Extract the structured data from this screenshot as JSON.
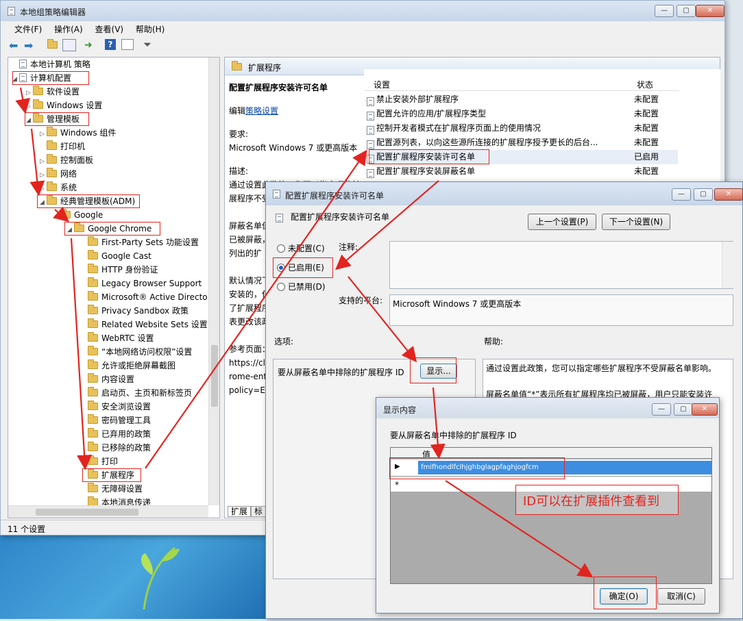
{
  "main_window": {
    "title": "本地组策略编辑器",
    "menu": [
      "文件(F)",
      "操作(A)",
      "查看(V)",
      "帮助(H)"
    ],
    "status": "11 个设置"
  },
  "tree": {
    "items": [
      {
        "label": "本地计算机 策略"
      },
      {
        "label": "计算机配置"
      },
      {
        "label": "软件设置"
      },
      {
        "label": "Windows 设置"
      },
      {
        "label": "管理模板"
      },
      {
        "label": "Windows 组件"
      },
      {
        "label": "打印机"
      },
      {
        "label": "控制面板"
      },
      {
        "label": "网络"
      },
      {
        "label": "系统"
      },
      {
        "label": "经典管理模板(ADM)"
      },
      {
        "label": "Google"
      },
      {
        "label": "Google Chrome"
      },
      {
        "label": "First-Party Sets 功能设置"
      },
      {
        "label": "Google Cast"
      },
      {
        "label": "HTTP 身份验证"
      },
      {
        "label": "Legacy Browser Support"
      },
      {
        "label": "Microsoft® Active Directo"
      },
      {
        "label": "Privacy Sandbox 政策"
      },
      {
        "label": "Related Website Sets 设置"
      },
      {
        "label": "WebRTC 设置"
      },
      {
        "label": "“本地网络访问权限”设置"
      },
      {
        "label": "允许或拒绝屏幕截图"
      },
      {
        "label": "内容设置"
      },
      {
        "label": "启动页、主页和新标签页"
      },
      {
        "label": "安全浏览设置"
      },
      {
        "label": "密码管理工具"
      },
      {
        "label": "已弃用的政策"
      },
      {
        "label": "已移除的政策"
      },
      {
        "label": "打印"
      },
      {
        "label": "扩展程序"
      },
      {
        "label": "无障碍设置"
      },
      {
        "label": "本地消息传递"
      }
    ]
  },
  "detail": {
    "header": "扩展程序",
    "setting_title": "配置扩展程序安装许可名单",
    "edit_prefix": "编辑",
    "edit_link": "策略设置",
    "req_label": "要求:",
    "req_value": "Microsoft Windows 7 或更高版本",
    "desc_label": "描述:",
    "desc_lines": [
      "通过设置此政策，您可以指定哪些扩",
      "展程序不受",
      "",
      "屏蔽名单值",
      "已被屏蔽，",
      "列出的扩",
      "",
      "默认情况下",
      "安装的，但",
      "了扩展程序",
      "表更改该政",
      "",
      "参考页面：",
      "https://clo",
      "rome-ent",
      "policy=Ex"
    ],
    "tabs": [
      "扩展",
      "标"
    ]
  },
  "settings_list": {
    "col_setting": "设置",
    "col_state": "状态",
    "rows": [
      {
        "name": "禁止安装外部扩展程序",
        "state": "未配置"
      },
      {
        "name": "配置允许的应用/扩展程序类型",
        "state": "未配置"
      },
      {
        "name": "控制开发者模式在扩展程序页面上的使用情况",
        "state": "未配置"
      },
      {
        "name": "配置源列表，以向这些源所连接的扩展程序授予更长的后台...",
        "state": "未配置"
      },
      {
        "name": "配置扩展程序安装许可名单",
        "state": "已启用"
      },
      {
        "name": "配置扩展程序安装屏蔽名单",
        "state": "未配置"
      }
    ]
  },
  "policy_dialog": {
    "title": "配置扩展程序安装许可名单",
    "heading": "配置扩展程序安装许可名单",
    "prev_btn": "上一个设置(P)",
    "next_btn": "下一个设置(N)",
    "radio_not_configured": "未配置(C)",
    "radio_enabled": "已启用(E)",
    "radio_disabled": "已禁用(D)",
    "comment_label": "注释:",
    "platform_label": "支持的平台:",
    "platform_value": "Microsoft Windows 7 或更高版本",
    "options_label": "选项:",
    "help_label": "帮助:",
    "option_text": "要从屏蔽名单中排除的扩展程序 ID",
    "show_btn": "显示...",
    "help_lines": [
      "通过设置此政策，您可以指定哪些扩展程序不受屏蔽名单影响。",
      "",
      "屏蔽名单值“*”表示所有扩展程序均已被屏蔽，用户只能安装许"
    ]
  },
  "show_dialog": {
    "title": "显示内容",
    "label": "要从屏蔽名单中排除的扩展程序 ID",
    "col_value": "值",
    "row_value": "fmifhondlfclhjghbglagpfaghjogfcm",
    "new_row_marker": "*",
    "ok": "确定(O)",
    "cancel": "取消(C)"
  },
  "annotation": {
    "text": "ID可以在扩展插件查看到",
    "color": "#e2241f"
  }
}
